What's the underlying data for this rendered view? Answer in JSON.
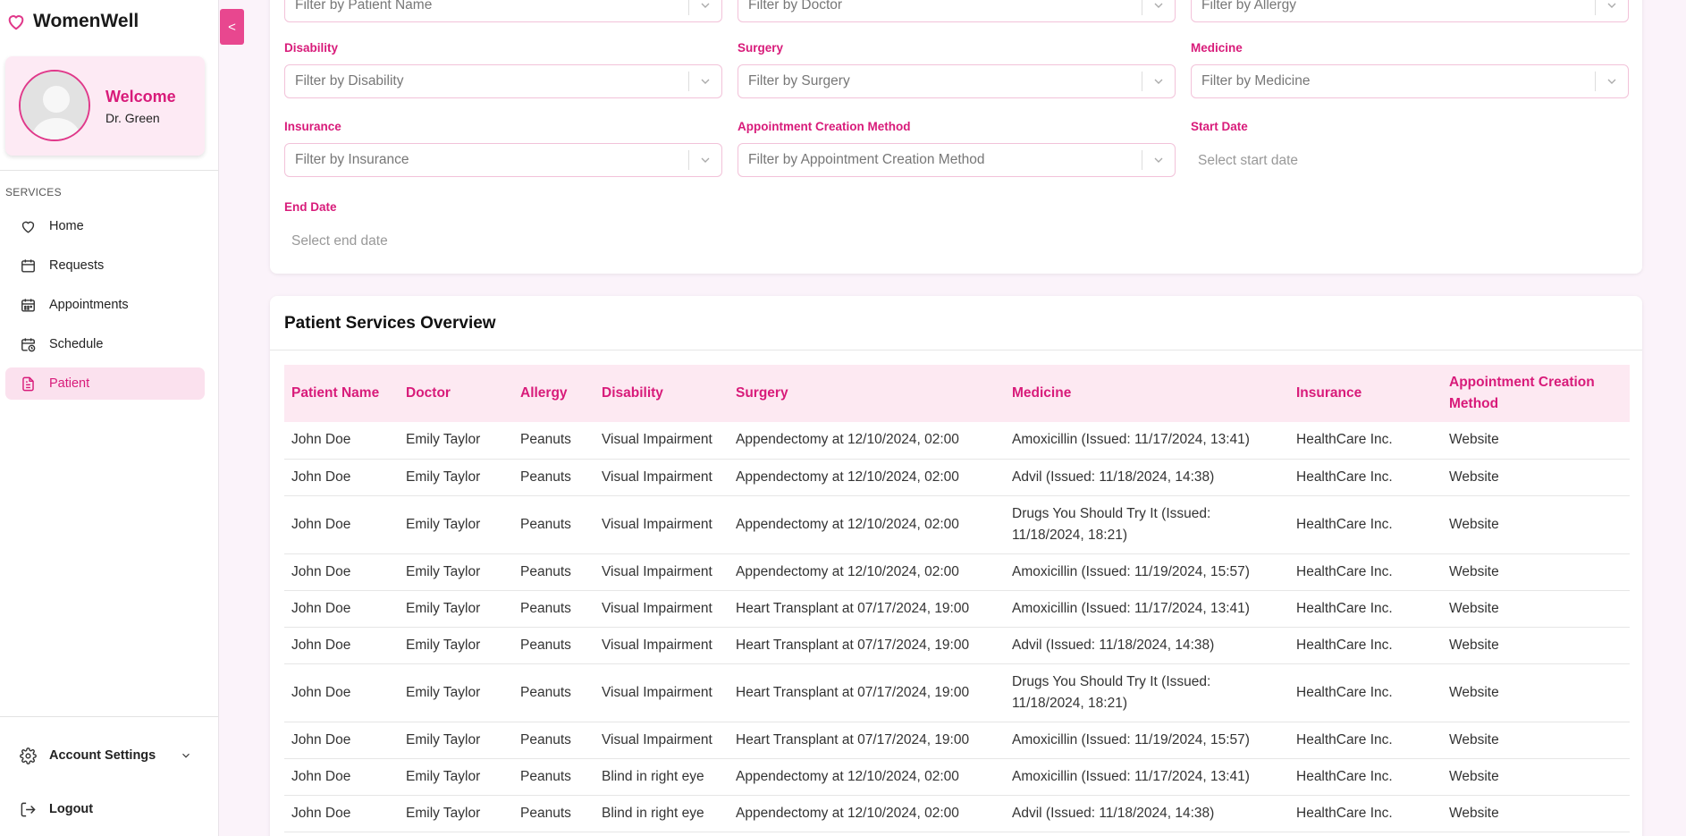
{
  "app": {
    "name": "WomenWell"
  },
  "profile": {
    "welcome": "Welcome",
    "name": "Dr. Green"
  },
  "sidebar": {
    "section_label": "SERVICES",
    "items": [
      {
        "label": "Home",
        "icon": "heart-icon"
      },
      {
        "label": "Requests",
        "icon": "calendar-icon"
      },
      {
        "label": "Appointments",
        "icon": "calendar-grid-icon"
      },
      {
        "label": "Schedule",
        "icon": "calendar-clock-icon"
      },
      {
        "label": "Patient",
        "icon": "document-icon",
        "active": true
      }
    ],
    "account_settings": "Account Settings",
    "logout": "Logout"
  },
  "collapse_button": "<",
  "filters": {
    "patient_name": {
      "placeholder": "Filter by Patient Name"
    },
    "doctor": {
      "placeholder": "Filter by Doctor"
    },
    "allergy": {
      "placeholder": "Filter by Allergy"
    },
    "disability": {
      "label": "Disability",
      "placeholder": "Filter by Disability"
    },
    "surgery": {
      "label": "Surgery",
      "placeholder": "Filter by Surgery"
    },
    "medicine": {
      "label": "Medicine",
      "placeholder": "Filter by Medicine"
    },
    "insurance": {
      "label": "Insurance",
      "placeholder": "Filter by Insurance"
    },
    "creation_method": {
      "label": "Appointment Creation Method",
      "placeholder": "Filter by Appointment Creation Method"
    },
    "start_date": {
      "label": "Start Date",
      "placeholder": "Select start date"
    },
    "end_date": {
      "label": "End Date",
      "placeholder": "Select end date"
    }
  },
  "table": {
    "title": "Patient Services Overview",
    "columns": [
      "Patient Name",
      "Doctor",
      "Allergy",
      "Disability",
      "Surgery",
      "Medicine",
      "Insurance",
      "Appointment Creation Method"
    ],
    "rows": [
      [
        "John Doe",
        "Emily Taylor",
        "Peanuts",
        "Visual Impairment",
        "Appendectomy at 12/10/2024, 02:00",
        "Amoxicillin (Issued: 11/17/2024, 13:41)",
        "HealthCare Inc.",
        "Website"
      ],
      [
        "John Doe",
        "Emily Taylor",
        "Peanuts",
        "Visual Impairment",
        "Appendectomy at 12/10/2024, 02:00",
        "Advil (Issued: 11/18/2024, 14:38)",
        "HealthCare Inc.",
        "Website"
      ],
      [
        "John Doe",
        "Emily Taylor",
        "Peanuts",
        "Visual Impairment",
        "Appendectomy at 12/10/2024, 02:00",
        "Drugs You Should Try It (Issued: 11/18/2024, 18:21)",
        "HealthCare Inc.",
        "Website"
      ],
      [
        "John Doe",
        "Emily Taylor",
        "Peanuts",
        "Visual Impairment",
        "Appendectomy at 12/10/2024, 02:00",
        "Amoxicillin (Issued: 11/19/2024, 15:57)",
        "HealthCare Inc.",
        "Website"
      ],
      [
        "John Doe",
        "Emily Taylor",
        "Peanuts",
        "Visual Impairment",
        "Heart Transplant at 07/17/2024, 19:00",
        "Amoxicillin (Issued: 11/17/2024, 13:41)",
        "HealthCare Inc.",
        "Website"
      ],
      [
        "John Doe",
        "Emily Taylor",
        "Peanuts",
        "Visual Impairment",
        "Heart Transplant at 07/17/2024, 19:00",
        "Advil (Issued: 11/18/2024, 14:38)",
        "HealthCare Inc.",
        "Website"
      ],
      [
        "John Doe",
        "Emily Taylor",
        "Peanuts",
        "Visual Impairment",
        "Heart Transplant at 07/17/2024, 19:00",
        "Drugs You Should Try It (Issued: 11/18/2024, 18:21)",
        "HealthCare Inc.",
        "Website"
      ],
      [
        "John Doe",
        "Emily Taylor",
        "Peanuts",
        "Visual Impairment",
        "Heart Transplant at 07/17/2024, 19:00",
        "Amoxicillin (Issued: 11/19/2024, 15:57)",
        "HealthCare Inc.",
        "Website"
      ],
      [
        "John Doe",
        "Emily Taylor",
        "Peanuts",
        "Blind in right eye",
        "Appendectomy at 12/10/2024, 02:00",
        "Amoxicillin (Issued: 11/17/2024, 13:41)",
        "HealthCare Inc.",
        "Website"
      ],
      [
        "John Doe",
        "Emily Taylor",
        "Peanuts",
        "Blind in right eye",
        "Appendectomy at 12/10/2024, 02:00",
        "Advil (Issued: 11/18/2024, 14:38)",
        "HealthCare Inc.",
        "Website"
      ]
    ]
  },
  "colors": {
    "accent": "#d81b7a",
    "button": "#e8478f",
    "header_bg": "#fde9f2",
    "page_bg": "#fbf3fa"
  }
}
